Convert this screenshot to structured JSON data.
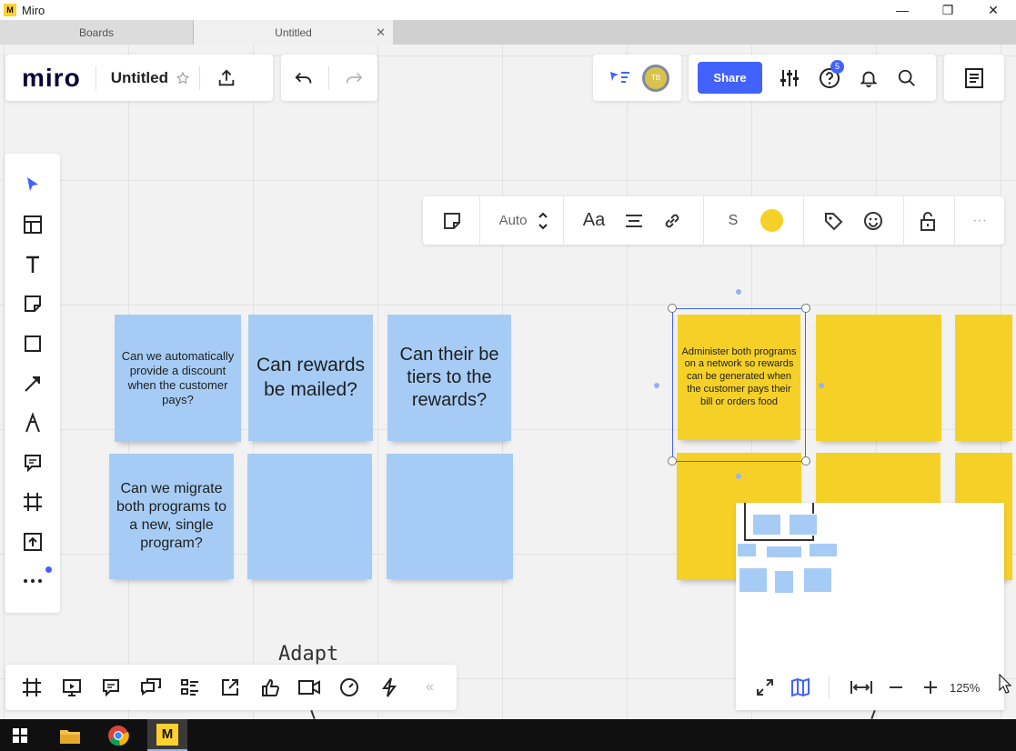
{
  "window": {
    "title": "Miro",
    "app_icon_text": "M"
  },
  "tabs": [
    {
      "label": "Boards",
      "active": false
    },
    {
      "label": "Untitled",
      "active": true,
      "close": "✕"
    }
  ],
  "header": {
    "logo": "miro",
    "board_title": "Untitled",
    "share_label": "Share",
    "avatar_initials": "TB",
    "help_badge": "5"
  },
  "context_toolbar": {
    "size_value": "Auto",
    "font_label": "Aa",
    "size_letter": "S",
    "sticky_color": "#f5d128",
    "more": "···"
  },
  "notes": {
    "blue": [
      "Can we automatically provide a discount when the customer pays?",
      "Can rewards be mailed?",
      "Can their be tiers to the rewards?",
      "Can we migrate both programs to a new, single program?",
      "",
      ""
    ],
    "yellow": [
      "Administer both programs on a network so rewards can be generated when the customer pays their bill or orders food"
    ]
  },
  "canvas_text": {
    "adapt": "Adapt"
  },
  "minimap": {
    "zoom": "125%"
  },
  "bottom_toolbar": {
    "collapse": "«"
  },
  "colors": {
    "accent": "#4262ff",
    "blue_note": "#a6ccf5",
    "yellow_note": "#f5d128"
  }
}
